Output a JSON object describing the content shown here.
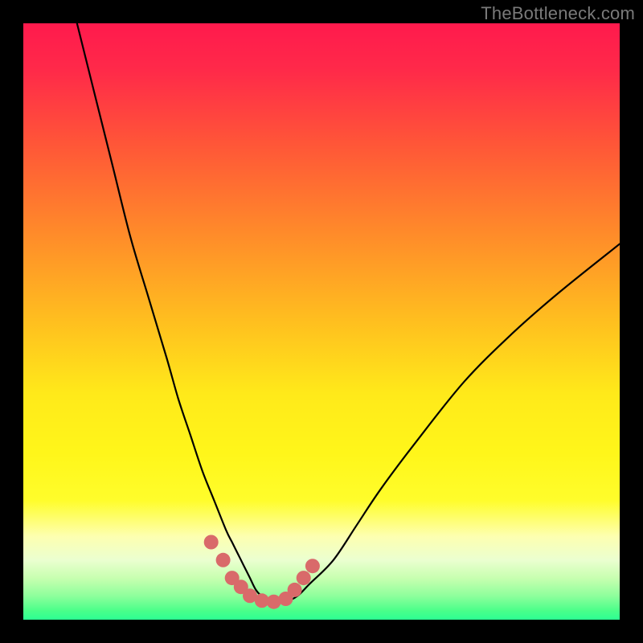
{
  "watermark": "TheBottleneck.com",
  "gradient_stops": [
    {
      "offset": 0.0,
      "color": "#ff1a4d"
    },
    {
      "offset": 0.08,
      "color": "#ff2a49"
    },
    {
      "offset": 0.2,
      "color": "#ff5538"
    },
    {
      "offset": 0.35,
      "color": "#ff8a2a"
    },
    {
      "offset": 0.5,
      "color": "#ffbf1f"
    },
    {
      "offset": 0.62,
      "color": "#ffe91a"
    },
    {
      "offset": 0.72,
      "color": "#fff61a"
    },
    {
      "offset": 0.8,
      "color": "#fffd2b"
    },
    {
      "offset": 0.86,
      "color": "#fdffb0"
    },
    {
      "offset": 0.9,
      "color": "#ebffd0"
    },
    {
      "offset": 0.93,
      "color": "#c8ffb0"
    },
    {
      "offset": 0.96,
      "color": "#8eff9c"
    },
    {
      "offset": 0.985,
      "color": "#4aff8a"
    },
    {
      "offset": 1.0,
      "color": "#2cff92"
    }
  ],
  "curve_color": "#000000",
  "marker_color": "#d96a6a",
  "chart_data": {
    "type": "line",
    "title": "",
    "xlabel": "",
    "ylabel": "",
    "xlim": [
      0,
      100
    ],
    "ylim": [
      0,
      100
    ],
    "grid": false,
    "series": [
      {
        "name": "bottleneck-curve",
        "x": [
          9,
          12,
          15,
          18,
          21,
          24,
          26,
          28,
          30,
          32,
          34,
          35,
          36,
          37,
          38,
          39,
          40,
          42,
          44,
          46,
          48,
          52,
          56,
          60,
          66,
          74,
          82,
          90,
          100
        ],
        "y": [
          100,
          88,
          76,
          64,
          54,
          44,
          37,
          31,
          25,
          20,
          15,
          13,
          11,
          9,
          7,
          5,
          4,
          3,
          3,
          4,
          6,
          10,
          16,
          22,
          30,
          40,
          48,
          55,
          63
        ]
      }
    ],
    "markers": {
      "name": "highlight-dots",
      "x": [
        31.5,
        33.5,
        35,
        36.5,
        38,
        40,
        42,
        44,
        45.5,
        47,
        48.5
      ],
      "y": [
        13,
        10,
        7,
        5.5,
        4,
        3.2,
        3,
        3.5,
        5,
        7,
        9
      ]
    }
  }
}
